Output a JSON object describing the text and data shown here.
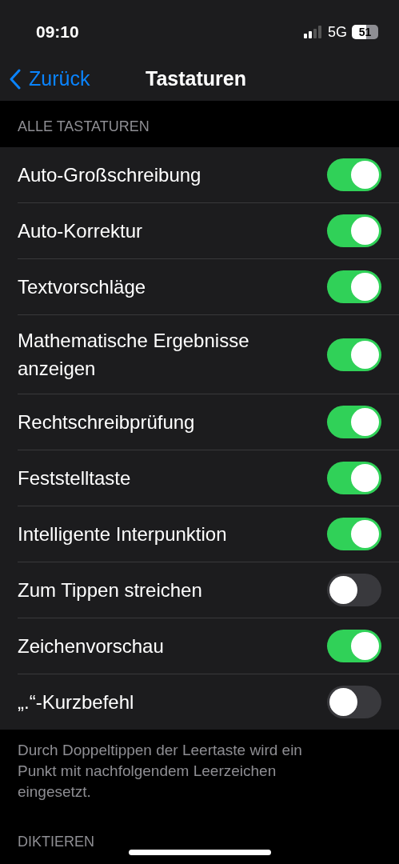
{
  "status_bar": {
    "time": "09:10",
    "network": "5G",
    "battery": "51"
  },
  "nav": {
    "back": "Zurück",
    "title": "Tastaturen"
  },
  "section_header": "ALLE TASTATUREN",
  "settings": [
    {
      "label": "Auto-Großschreibung",
      "on": true
    },
    {
      "label": "Auto-Korrektur",
      "on": true
    },
    {
      "label": "Textvorschläge",
      "on": true
    },
    {
      "label": "Mathematische Ergebnisse anzeigen",
      "on": true
    },
    {
      "label": "Rechtschreibprüfung",
      "on": true
    },
    {
      "label": "Feststelltaste",
      "on": true
    },
    {
      "label": "Intelligente Interpunktion",
      "on": true
    },
    {
      "label": "Zum Tippen streichen",
      "on": false
    },
    {
      "label": "Zeichenvorschau",
      "on": true
    },
    {
      "label": "„.“-Kurzbefehl",
      "on": false
    }
  ],
  "footer_note": "Durch Doppeltippen der Leertaste wird ein Punkt mit nachfolgendem Leerzeichen eingesetzt.",
  "next_section_header": "DIKTIEREN"
}
